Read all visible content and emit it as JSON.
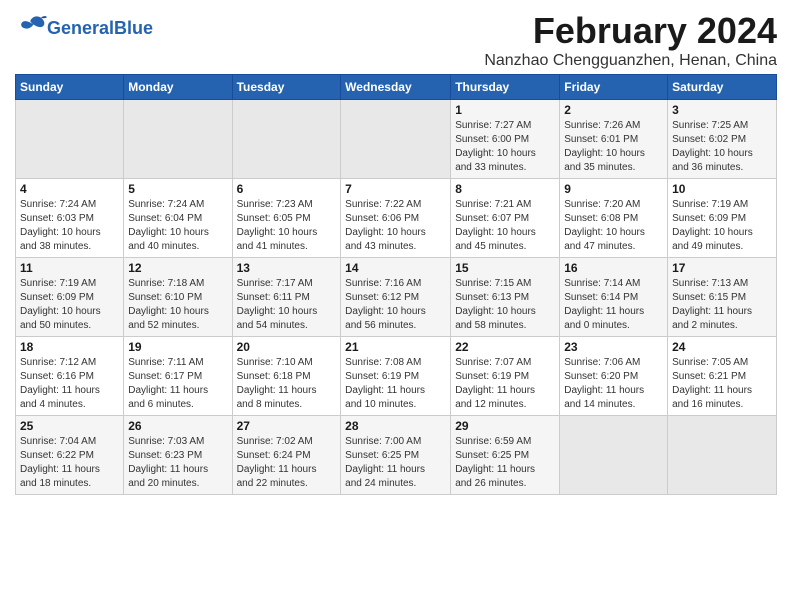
{
  "header": {
    "logo_text_general": "General",
    "logo_text_blue": "Blue",
    "title": "February 2024",
    "subtitle": "Nanzhao Chengguanzhen, Henan, China"
  },
  "days_of_week": [
    "Sunday",
    "Monday",
    "Tuesday",
    "Wednesday",
    "Thursday",
    "Friday",
    "Saturday"
  ],
  "weeks": [
    [
      {
        "day": "",
        "info": ""
      },
      {
        "day": "",
        "info": ""
      },
      {
        "day": "",
        "info": ""
      },
      {
        "day": "",
        "info": ""
      },
      {
        "day": "1",
        "info": "Sunrise: 7:27 AM\nSunset: 6:00 PM\nDaylight: 10 hours\nand 33 minutes."
      },
      {
        "day": "2",
        "info": "Sunrise: 7:26 AM\nSunset: 6:01 PM\nDaylight: 10 hours\nand 35 minutes."
      },
      {
        "day": "3",
        "info": "Sunrise: 7:25 AM\nSunset: 6:02 PM\nDaylight: 10 hours\nand 36 minutes."
      }
    ],
    [
      {
        "day": "4",
        "info": "Sunrise: 7:24 AM\nSunset: 6:03 PM\nDaylight: 10 hours\nand 38 minutes."
      },
      {
        "day": "5",
        "info": "Sunrise: 7:24 AM\nSunset: 6:04 PM\nDaylight: 10 hours\nand 40 minutes."
      },
      {
        "day": "6",
        "info": "Sunrise: 7:23 AM\nSunset: 6:05 PM\nDaylight: 10 hours\nand 41 minutes."
      },
      {
        "day": "7",
        "info": "Sunrise: 7:22 AM\nSunset: 6:06 PM\nDaylight: 10 hours\nand 43 minutes."
      },
      {
        "day": "8",
        "info": "Sunrise: 7:21 AM\nSunset: 6:07 PM\nDaylight: 10 hours\nand 45 minutes."
      },
      {
        "day": "9",
        "info": "Sunrise: 7:20 AM\nSunset: 6:08 PM\nDaylight: 10 hours\nand 47 minutes."
      },
      {
        "day": "10",
        "info": "Sunrise: 7:19 AM\nSunset: 6:09 PM\nDaylight: 10 hours\nand 49 minutes."
      }
    ],
    [
      {
        "day": "11",
        "info": "Sunrise: 7:19 AM\nSunset: 6:09 PM\nDaylight: 10 hours\nand 50 minutes."
      },
      {
        "day": "12",
        "info": "Sunrise: 7:18 AM\nSunset: 6:10 PM\nDaylight: 10 hours\nand 52 minutes."
      },
      {
        "day": "13",
        "info": "Sunrise: 7:17 AM\nSunset: 6:11 PM\nDaylight: 10 hours\nand 54 minutes."
      },
      {
        "day": "14",
        "info": "Sunrise: 7:16 AM\nSunset: 6:12 PM\nDaylight: 10 hours\nand 56 minutes."
      },
      {
        "day": "15",
        "info": "Sunrise: 7:15 AM\nSunset: 6:13 PM\nDaylight: 10 hours\nand 58 minutes."
      },
      {
        "day": "16",
        "info": "Sunrise: 7:14 AM\nSunset: 6:14 PM\nDaylight: 11 hours\nand 0 minutes."
      },
      {
        "day": "17",
        "info": "Sunrise: 7:13 AM\nSunset: 6:15 PM\nDaylight: 11 hours\nand 2 minutes."
      }
    ],
    [
      {
        "day": "18",
        "info": "Sunrise: 7:12 AM\nSunset: 6:16 PM\nDaylight: 11 hours\nand 4 minutes."
      },
      {
        "day": "19",
        "info": "Sunrise: 7:11 AM\nSunset: 6:17 PM\nDaylight: 11 hours\nand 6 minutes."
      },
      {
        "day": "20",
        "info": "Sunrise: 7:10 AM\nSunset: 6:18 PM\nDaylight: 11 hours\nand 8 minutes."
      },
      {
        "day": "21",
        "info": "Sunrise: 7:08 AM\nSunset: 6:19 PM\nDaylight: 11 hours\nand 10 minutes."
      },
      {
        "day": "22",
        "info": "Sunrise: 7:07 AM\nSunset: 6:19 PM\nDaylight: 11 hours\nand 12 minutes."
      },
      {
        "day": "23",
        "info": "Sunrise: 7:06 AM\nSunset: 6:20 PM\nDaylight: 11 hours\nand 14 minutes."
      },
      {
        "day": "24",
        "info": "Sunrise: 7:05 AM\nSunset: 6:21 PM\nDaylight: 11 hours\nand 16 minutes."
      }
    ],
    [
      {
        "day": "25",
        "info": "Sunrise: 7:04 AM\nSunset: 6:22 PM\nDaylight: 11 hours\nand 18 minutes."
      },
      {
        "day": "26",
        "info": "Sunrise: 7:03 AM\nSunset: 6:23 PM\nDaylight: 11 hours\nand 20 minutes."
      },
      {
        "day": "27",
        "info": "Sunrise: 7:02 AM\nSunset: 6:24 PM\nDaylight: 11 hours\nand 22 minutes."
      },
      {
        "day": "28",
        "info": "Sunrise: 7:00 AM\nSunset: 6:25 PM\nDaylight: 11 hours\nand 24 minutes."
      },
      {
        "day": "29",
        "info": "Sunrise: 6:59 AM\nSunset: 6:25 PM\nDaylight: 11 hours\nand 26 minutes."
      },
      {
        "day": "",
        "info": ""
      },
      {
        "day": "",
        "info": ""
      }
    ]
  ]
}
